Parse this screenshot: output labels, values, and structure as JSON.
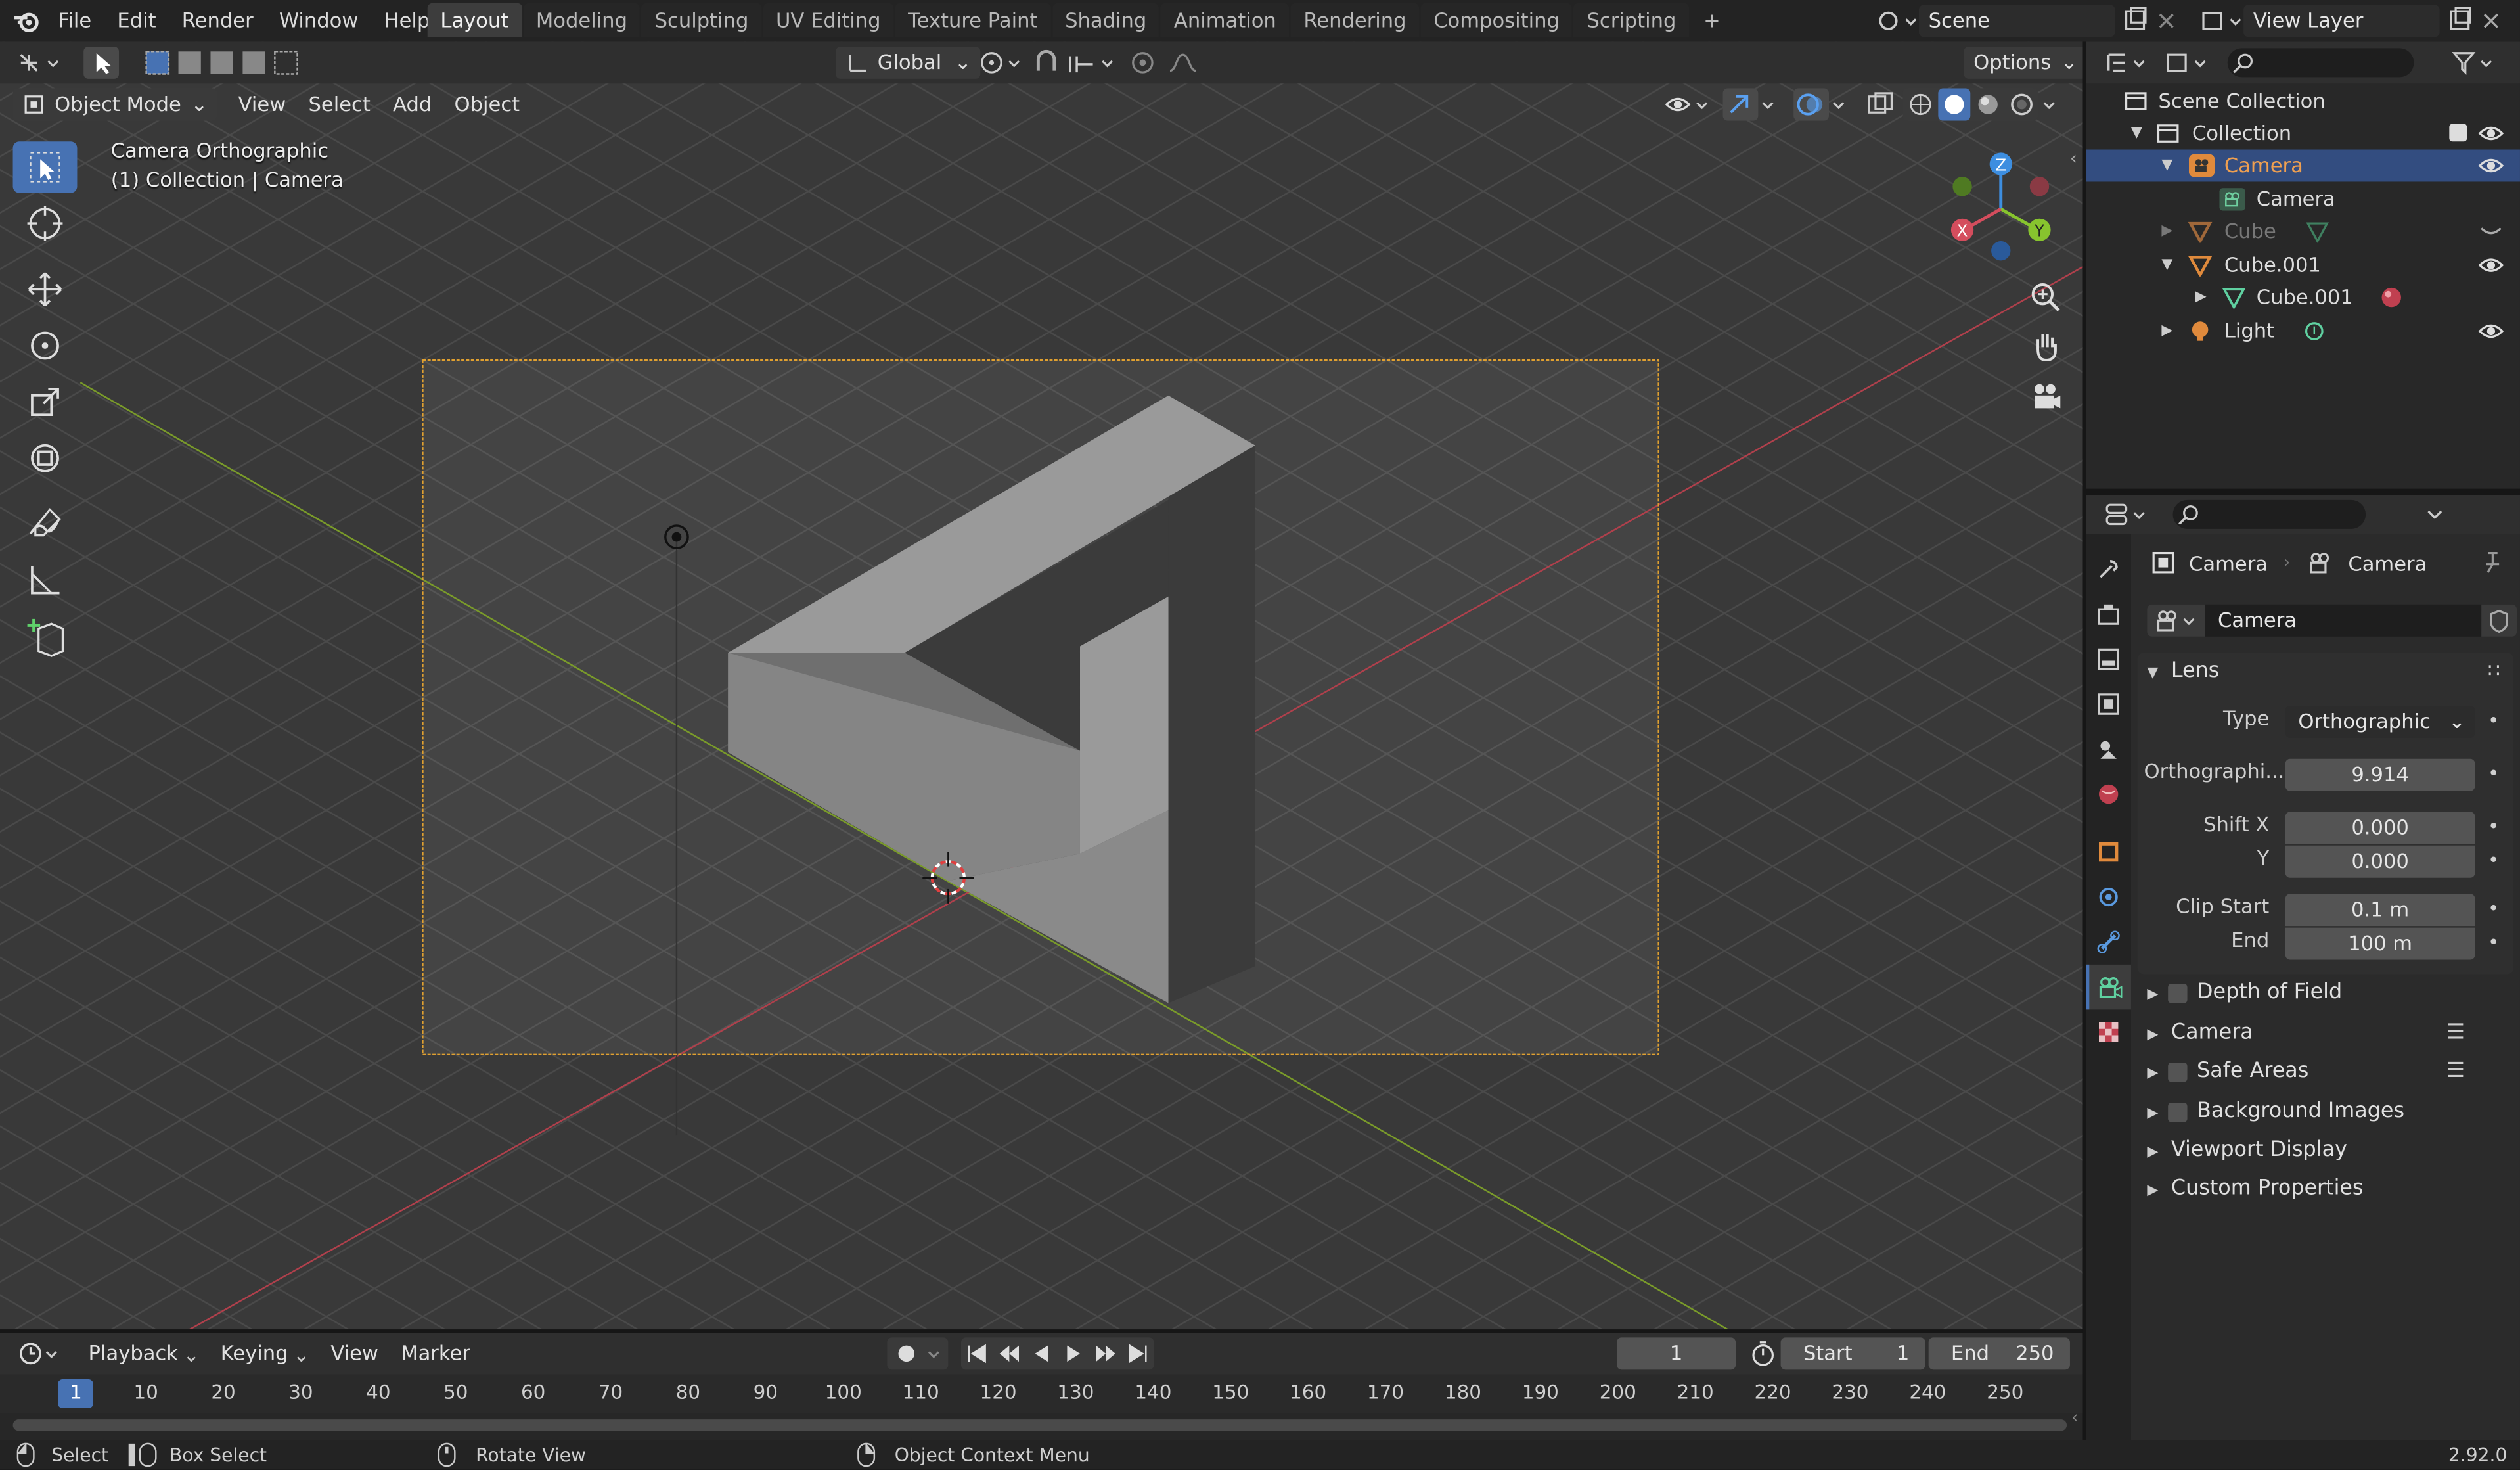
{
  "app": {
    "menus": [
      "File",
      "Edit",
      "Render",
      "Window",
      "Help"
    ],
    "workspaces": [
      "Layout",
      "Modeling",
      "Sculpting",
      "UV Editing",
      "Texture Paint",
      "Shading",
      "Animation",
      "Rendering",
      "Compositing",
      "Scripting"
    ],
    "active_workspace": "Layout",
    "add_workspace": "+",
    "scene": "Scene",
    "view_layer": "View Layer",
    "version": "2.92.0"
  },
  "viewport": {
    "transform_orientation": "Global",
    "options_label": "Options",
    "mode": "Object Mode",
    "header_menus": [
      "View",
      "Select",
      "Add",
      "Object"
    ],
    "overlay_line1": "Camera Orthographic",
    "overlay_line2": "(1) Collection | Camera",
    "gizmo_axes": {
      "x": "X",
      "y": "Y",
      "z": "Z"
    },
    "colors": {
      "x_axis": "#d44d5d",
      "y_axis": "#87c42e",
      "z_axis": "#3d8ee0",
      "camera_frame": "#e0a030"
    }
  },
  "outliner": {
    "root": "Scene Collection",
    "items": [
      {
        "label": "Collection",
        "level": 1
      },
      {
        "label": "Camera",
        "level": 2,
        "selected": true
      },
      {
        "label": "Camera",
        "level": 3
      },
      {
        "label": "Cube",
        "level": 2,
        "hidden": true
      },
      {
        "label": "Cube.001",
        "level": 2
      },
      {
        "label": "Cube.001",
        "level": 3
      },
      {
        "label": "Light",
        "level": 2
      }
    ]
  },
  "properties": {
    "breadcrumb_object": "Camera",
    "breadcrumb_data": "Camera",
    "datablock_name": "Camera",
    "lens_panel": "Lens",
    "type_label": "Type",
    "type_value": "Orthographic",
    "ortho_label": "Orthographi...",
    "ortho_value": "9.914",
    "shiftx_label": "Shift X",
    "shiftx_value": "0.000",
    "shifty_label": "Y",
    "shifty_value": "0.000",
    "clipstart_label": "Clip Start",
    "clipstart_value": "0.1 m",
    "clipend_label": "End",
    "clipend_value": "100 m",
    "panels": [
      "Depth of Field",
      "Camera",
      "Safe Areas",
      "Background Images",
      "Viewport Display",
      "Custom Properties"
    ]
  },
  "timeline": {
    "menus": [
      "Playback",
      "Keying",
      "View",
      "Marker"
    ],
    "current_frame": "1",
    "start_label": "Start",
    "start_value": "1",
    "end_label": "End",
    "end_value": "250",
    "ruler": [
      "1",
      "10",
      "20",
      "30",
      "40",
      "50",
      "60",
      "70",
      "80",
      "90",
      "100",
      "110",
      "120",
      "130",
      "140",
      "150",
      "160",
      "170",
      "180",
      "190",
      "200",
      "210",
      "220",
      "230",
      "240",
      "250"
    ]
  },
  "statusbar": {
    "select": "Select",
    "box_select": "Box Select",
    "rotate_view": "Rotate View",
    "context_menu": "Object Context Menu"
  }
}
